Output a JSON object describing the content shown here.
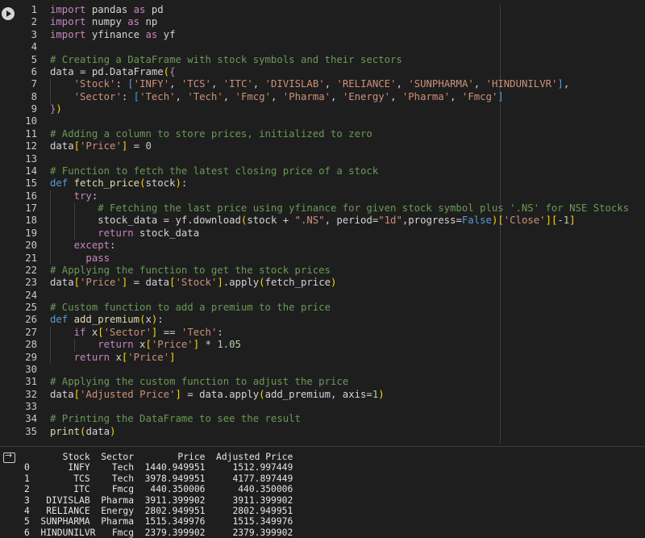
{
  "code_lines": [
    {
      "n": "1",
      "indent": 0,
      "html": "<span class=\"kc\">import</span> pandas <span class=\"kc\">as</span> pd"
    },
    {
      "n": "2",
      "indent": 0,
      "html": "<span class=\"kc\">import</span> numpy <span class=\"kc\">as</span> np"
    },
    {
      "n": "3",
      "indent": 0,
      "html": "<span class=\"kc\">import</span> yfinance <span class=\"kc\">as</span> yf"
    },
    {
      "n": "4",
      "indent": 0,
      "html": ""
    },
    {
      "n": "5",
      "indent": 0,
      "html": "<span class=\"c\"># Creating a DataFrame with stock symbols and their sectors</span>"
    },
    {
      "n": "6",
      "indent": 0,
      "html": "data = pd.DataFrame<span class=\"p\">(</span><span class=\"kc\">{</span>"
    },
    {
      "n": "7",
      "indent": 1,
      "html": "    <span class=\"s\">'Stock'</span>: <span class=\"k\">[</span><span class=\"s\">'INFY'</span>, <span class=\"s\">'TCS'</span>, <span class=\"s\">'ITC'</span>, <span class=\"s\">'DIVISLAB'</span>, <span class=\"s\">'RELIANCE'</span>, <span class=\"s\">'SUNPHARMA'</span>, <span class=\"s\">'HINDUNILVR'</span><span class=\"k\">]</span>,"
    },
    {
      "n": "8",
      "indent": 1,
      "html": "    <span class=\"s\">'Sector'</span>: <span class=\"k\">[</span><span class=\"s\">'Tech'</span>, <span class=\"s\">'Tech'</span>, <span class=\"s\">'Fmcg'</span>, <span class=\"s\">'Pharma'</span>, <span class=\"s\">'Energy'</span>, <span class=\"s\">'Pharma'</span>, <span class=\"s\">'Fmcg'</span><span class=\"k\">]</span>"
    },
    {
      "n": "9",
      "indent": 0,
      "html": "<span class=\"kc\">}</span><span class=\"p\">)</span>"
    },
    {
      "n": "10",
      "indent": 0,
      "html": ""
    },
    {
      "n": "11",
      "indent": 0,
      "html": "<span class=\"c\"># Adding a column to store prices, initialized to zero</span>"
    },
    {
      "n": "12",
      "indent": 0,
      "html": "data<span class=\"p\">[</span><span class=\"s\">'Price'</span><span class=\"p\">]</span> = <span class=\"n\">0</span>"
    },
    {
      "n": "13",
      "indent": 0,
      "html": ""
    },
    {
      "n": "14",
      "indent": 0,
      "html": "<span class=\"c\"># Function to fetch the latest closing price of a stock</span>"
    },
    {
      "n": "15",
      "indent": 0,
      "html": "<span class=\"k\">def</span> <span class=\"f\">fetch_price</span><span class=\"p\">(</span>stock<span class=\"p\">)</span>:"
    },
    {
      "n": "16",
      "indent": 1,
      "html": "    <span class=\"kc\">try</span>:"
    },
    {
      "n": "17",
      "indent": 2,
      "html": "        <span class=\"c\"># Fetching the last price using yfinance for given stock symbol plus '.NS' for NSE Stocks</span>"
    },
    {
      "n": "18",
      "indent": 2,
      "html": "        stock_data = yf.download<span class=\"p\">(</span>stock + <span class=\"s\">\".NS\"</span>, period=<span class=\"s\">\"1d\"</span>,progress=<span class=\"k\">False</span><span class=\"p\">)</span><span class=\"p\">[</span><span class=\"s\">'Close'</span><span class=\"p\">]</span><span class=\"p\">[</span>-<span class=\"n\">1</span><span class=\"p\">]</span>"
    },
    {
      "n": "19",
      "indent": 2,
      "html": "        <span class=\"kc\">return</span> stock_data"
    },
    {
      "n": "20",
      "indent": 1,
      "html": "    <span class=\"kc\">except</span>:"
    },
    {
      "n": "21",
      "indent": 1,
      "html": "      <span class=\"kc\">pass</span>"
    },
    {
      "n": "22",
      "indent": 0,
      "html": "<span class=\"c\"># Applying the function to get the stock prices</span>"
    },
    {
      "n": "23",
      "indent": 0,
      "html": "data<span class=\"p\">[</span><span class=\"s\">'Price'</span><span class=\"p\">]</span> = data<span class=\"p\">[</span><span class=\"s\">'Stock'</span><span class=\"p\">]</span>.apply<span class=\"p\">(</span>fetch_price<span class=\"p\">)</span>"
    },
    {
      "n": "24",
      "indent": 0,
      "html": ""
    },
    {
      "n": "25",
      "indent": 0,
      "html": "<span class=\"c\"># Custom function to add a premium to the price</span>"
    },
    {
      "n": "26",
      "indent": 0,
      "html": "<span class=\"k\">def</span> <span class=\"f\">add_premium</span><span class=\"p\">(</span>x<span class=\"p\">)</span>:"
    },
    {
      "n": "27",
      "indent": 1,
      "html": "    <span class=\"kc\">if</span> x<span class=\"p\">[</span><span class=\"s\">'Sector'</span><span class=\"p\">]</span> == <span class=\"s\">'Tech'</span>:"
    },
    {
      "n": "28",
      "indent": 2,
      "html": "        <span class=\"kc\">return</span> x<span class=\"p\">[</span><span class=\"s\">'Price'</span><span class=\"p\">]</span> * <span class=\"n\">1.05</span>"
    },
    {
      "n": "29",
      "indent": 1,
      "html": "    <span class=\"kc\">return</span> x<span class=\"p\">[</span><span class=\"s\">'Price'</span><span class=\"p\">]</span>"
    },
    {
      "n": "30",
      "indent": 0,
      "html": ""
    },
    {
      "n": "31",
      "indent": 0,
      "html": "<span class=\"c\"># Applying the custom function to adjust the price</span>"
    },
    {
      "n": "32",
      "indent": 0,
      "html": "data<span class=\"p\">[</span><span class=\"s\">'Adjusted Price'</span><span class=\"p\">]</span> = data.apply<span class=\"p\">(</span>add_premium, axis=<span class=\"n\">1</span><span class=\"p\">)</span>"
    },
    {
      "n": "33",
      "indent": 0,
      "html": ""
    },
    {
      "n": "34",
      "indent": 0,
      "html": "<span class=\"c\"># Printing the DataFrame to see the result</span>"
    },
    {
      "n": "35",
      "indent": 0,
      "html": "<span class=\"f\">print</span><span class=\"p\">(</span>data<span class=\"p\">)</span>"
    }
  ],
  "output": {
    "text": "       Stock  Sector        Price  Adjusted Price\n0       INFY    Tech  1440.949951     1512.997449\n1        TCS    Tech  3978.949951     4177.897449\n2        ITC    Fmcg   440.350006      440.350006\n3   DIVISLAB  Pharma  3911.399902     3911.399902\n4   RELIANCE  Energy  2802.949951     2802.949951\n5  SUNPHARMA  Pharma  1515.349976     1515.349976\n6  HINDUNILVR   Fmcg  2379.399902     2379.399902"
  },
  "icons": {
    "run": "play-circle-icon",
    "output": "output-redirect-icon"
  },
  "colors": {
    "background": "#1e1e1e",
    "comment": "#6a9955",
    "string": "#ce9178",
    "keyword": "#569cd6",
    "control": "#c586c0",
    "function": "#dcdcaa",
    "number": "#b5cea8",
    "bracket": "#ffd700"
  }
}
